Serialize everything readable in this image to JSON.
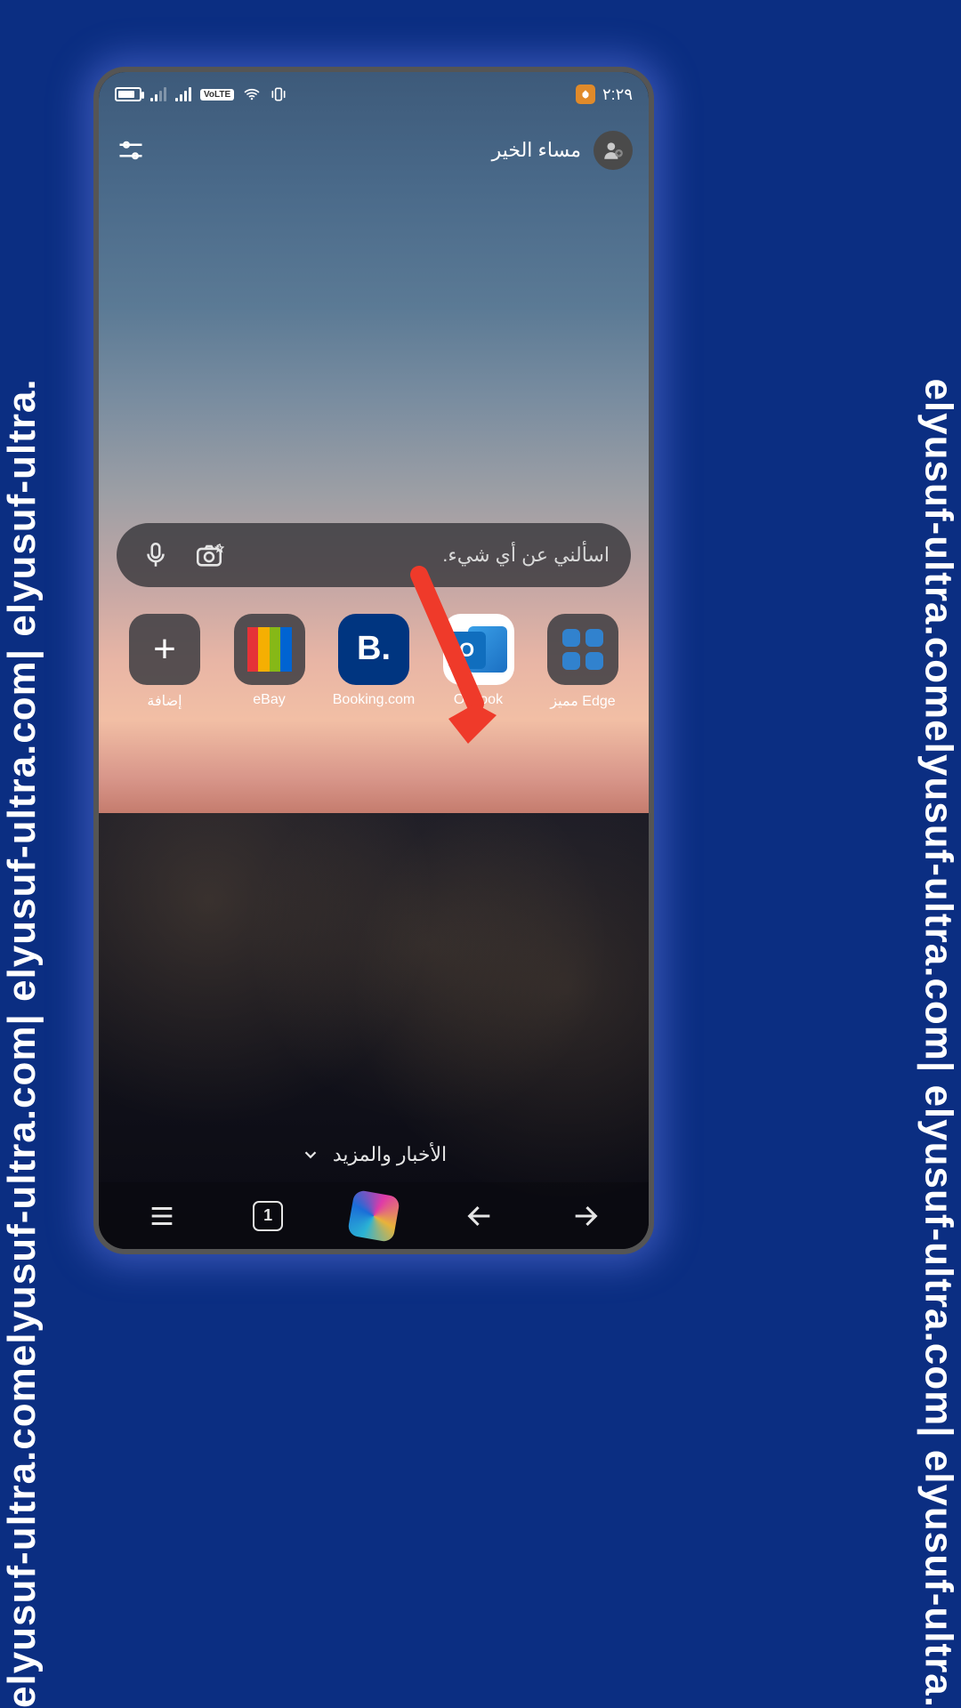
{
  "watermark": "elyusuf-ultra.comelyusuf-ultra.com| elyusuf-ultra.com| elyusuf-ultra.",
  "statusBar": {
    "time": "٢:٢٩",
    "volte": "VoLTE"
  },
  "header": {
    "greeting": "مساء الخير"
  },
  "searchBar": {
    "placeholder": "اسألني عن أي شيء."
  },
  "apps": {
    "add": "إضافة",
    "ebay": "eBay",
    "booking": "Booking.com",
    "outlook": "Outlook",
    "edge": "مميز Edge",
    "bookingGlyph": "B.",
    "outlookGlyph": "O"
  },
  "newsRow": {
    "label": "الأخبار والمزيد"
  },
  "bottomNav": {
    "tabCount": "1"
  }
}
